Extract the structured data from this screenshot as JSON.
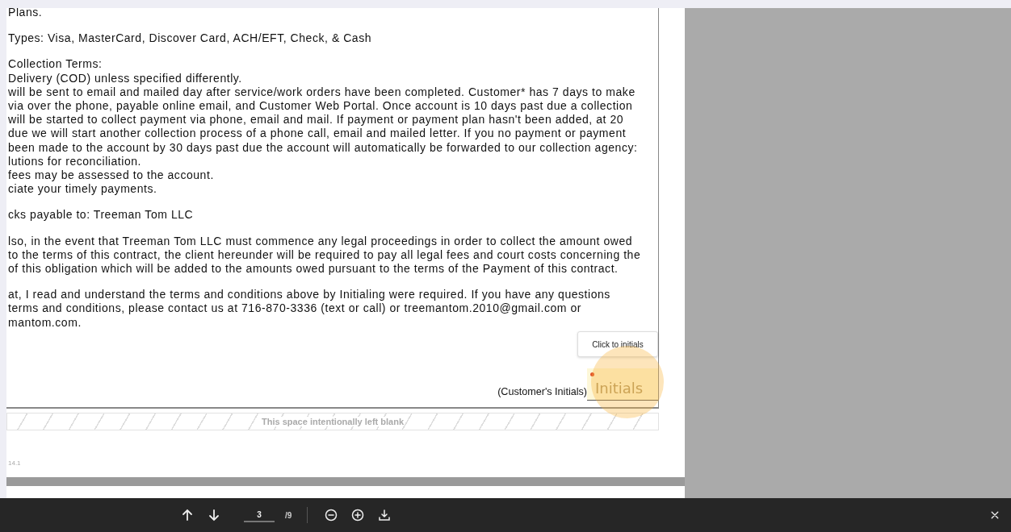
{
  "document": {
    "paragraphs": [
      {
        "lines": [
          "Plans."
        ]
      },
      {
        "lines": [
          "Types: Visa, MasterCard, Discover Card, ACH/EFT, Check, & Cash"
        ]
      },
      {
        "lines": [
          "Collection Terms:",
          "Delivery (COD) unless specified differently.",
          "will be sent to email and mailed day after service/work orders have been completed. Customer* has 7 days to make",
          "via over the phone, payable online email, and Customer Web Portal. Once account is 10 days past due a collection",
          "will be started to collect payment via phone, email and mail. If payment or payment plan hasn't been added, at 20",
          "due we will start another collection process of a phone call, email and mailed letter. If you no payment or payment",
          "been made to the account by 30 days past due the account will automatically be forwarded to our collection agency:",
          "lutions for reconciliation.",
          "fees may be assessed to the account.",
          "ciate your timely payments."
        ]
      },
      {
        "lines": [
          "cks payable to: Treeman Tom LLC"
        ]
      },
      {
        "lines": [
          "lso, in the event that Treeman Tom LLC must commence any legal proceedings in order to collect the amount owed",
          "to the terms of this contract, the client hereunder will be required to pay all legal fees and court costs concerning the",
          "of this obligation which will be added to the amounts owed pursuant to the terms of the Payment of this contract."
        ]
      },
      {
        "lines": [
          "at, I read and understand the terms and conditions above by Initialing were required. If you have any questions",
          "terms and conditions, please contact us at 716-870-3336 (text or call) or treemantom.2010@gmail.com or",
          "mantom.com."
        ]
      }
    ],
    "initials_tooltip": "Click to initials",
    "initials_label": "(Customer's Initials)",
    "initials_field": {
      "placeholder": "Initials",
      "required": true,
      "highlighted": true
    },
    "blank_notice": "This space intentionally left blank",
    "footer_code": "14.1"
  },
  "toolbar": {
    "page": "3",
    "page_count": "/9"
  }
}
